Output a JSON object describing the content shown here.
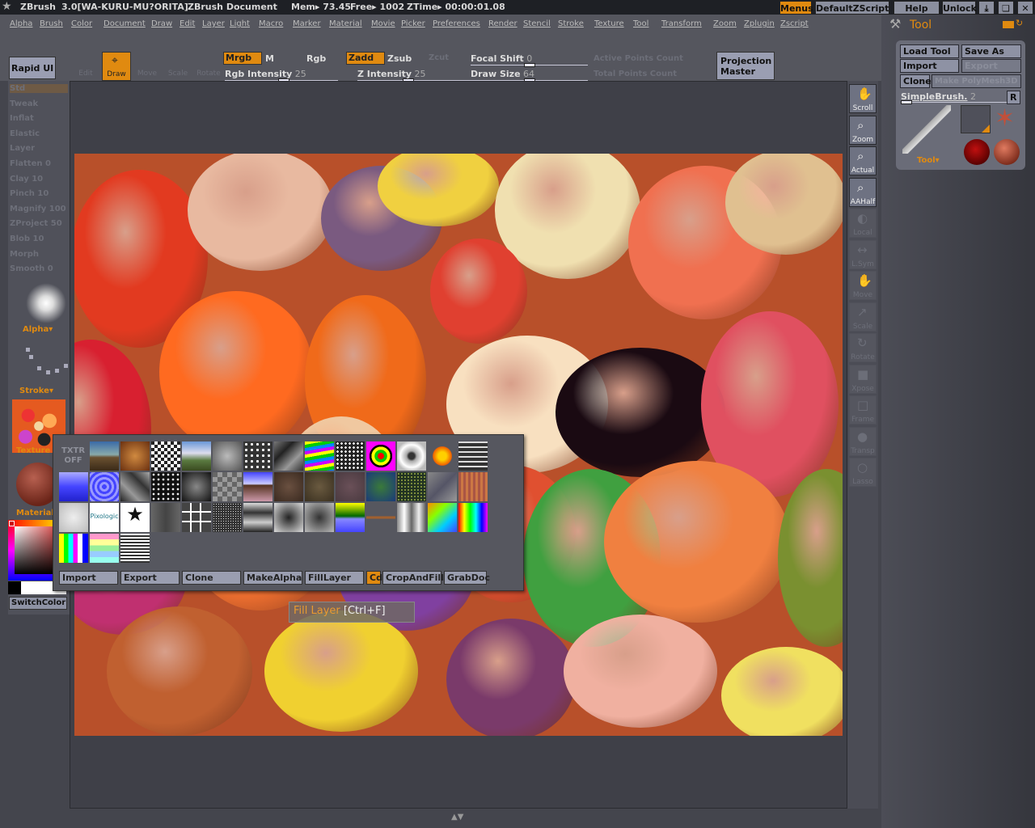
{
  "titlebar": {
    "app": "ZBrush",
    "version": "3.0[WA-KURU-MU?ORITA]",
    "document": "ZBrush Document",
    "mem": "Mem▸ 73.45",
    "free": "Free▸ 1002",
    "ztime": "ZTime▸ 00:00:01.08",
    "buttons": [
      "Menus",
      "DefaultZScript",
      "Help",
      "Unlock"
    ],
    "window_icons": [
      "minimize-icon",
      "restore-icon",
      "close-icon"
    ]
  },
  "menu": [
    "Alpha",
    "Brush",
    "Color",
    "Document",
    "Draw",
    "Edit",
    "Layer",
    "Light",
    "Macro",
    "Marker",
    "Material",
    "Movie",
    "Picker",
    "Preferences",
    "Render",
    "Stencil",
    "Stroke",
    "Texture",
    "Tool",
    "Transform",
    "Zoom",
    "Zplugin",
    "Zscript"
  ],
  "toolbar": {
    "rapid_ui": "Rapid UI",
    "modes": [
      "Edit",
      "Draw",
      "Move",
      "Scale",
      "Rotate"
    ],
    "active_mode": "Draw",
    "mrgb": "Mrgb",
    "m": "M",
    "rgb": "Rgb",
    "zadd": "Zadd",
    "zsub": "Zsub",
    "zcut": "Zcut",
    "rgb_intensity_label": "Rgb Intensity",
    "rgb_intensity": 25,
    "z_intensity_label": "Z Intensity",
    "z_intensity": 25,
    "focal_shift_label": "Focal Shift",
    "focal_shift": 0,
    "draw_size_label": "Draw Size",
    "draw_size": 64,
    "active_points": "Active Points Count",
    "total_points": "Total Points Count",
    "projection_master": [
      "Projection",
      "Master"
    ],
    "accent": "#e08a10"
  },
  "left": {
    "brushes": [
      "Std",
      "Tweak",
      "Inflat",
      "Elastic",
      "Layer",
      "Flatten 0",
      "Clay 10",
      "Pinch 10",
      "Magnify 100",
      "ZProject 50",
      "Blob 10",
      "Morph",
      "Smooth 0"
    ],
    "alpha": "Alpha",
    "stroke": "Stroke",
    "texture": "Texture",
    "material": "Material",
    "switch_color": "SwitchColor"
  },
  "shelf": [
    {
      "label": "Scroll",
      "enabled": true
    },
    {
      "label": "Zoom",
      "enabled": true
    },
    {
      "label": "Actual",
      "enabled": true
    },
    {
      "label": "AAHalf",
      "enabled": true
    },
    {
      "label": "Local",
      "enabled": false
    },
    {
      "label": "L.Sym",
      "enabled": false
    },
    {
      "label": "Move",
      "enabled": false
    },
    {
      "label": "Scale",
      "enabled": false
    },
    {
      "label": "Rotate",
      "enabled": false
    },
    {
      "label": "Xpose",
      "enabled": false
    },
    {
      "label": "Frame",
      "enabled": false
    },
    {
      "label": "Transp",
      "enabled": false
    },
    {
      "label": "Lasso",
      "enabled": false
    }
  ],
  "tool_panel": {
    "title": "Tool",
    "load_tool": "Load Tool",
    "save_as": "Save As",
    "import": "Import",
    "export": "Export",
    "clone": "Clone",
    "make_polymesh": "Make PolyMesh3D",
    "brush_name": "SimpleBrush.",
    "brush_value": 2,
    "r": "R",
    "tool_label": "Tool"
  },
  "texture_popup": {
    "off_label": [
      "TXTR",
      "OFF"
    ],
    "pixologic_label": "Pixologic",
    "buttons": [
      "Import",
      "Export",
      "Clone",
      "MakeAlpha",
      "FillLayer",
      "Cd",
      "CropAndFill",
      "GrabDoc"
    ]
  },
  "tooltip": {
    "name": "Fill Layer",
    "shortcut": "[Ctrl+F]"
  }
}
